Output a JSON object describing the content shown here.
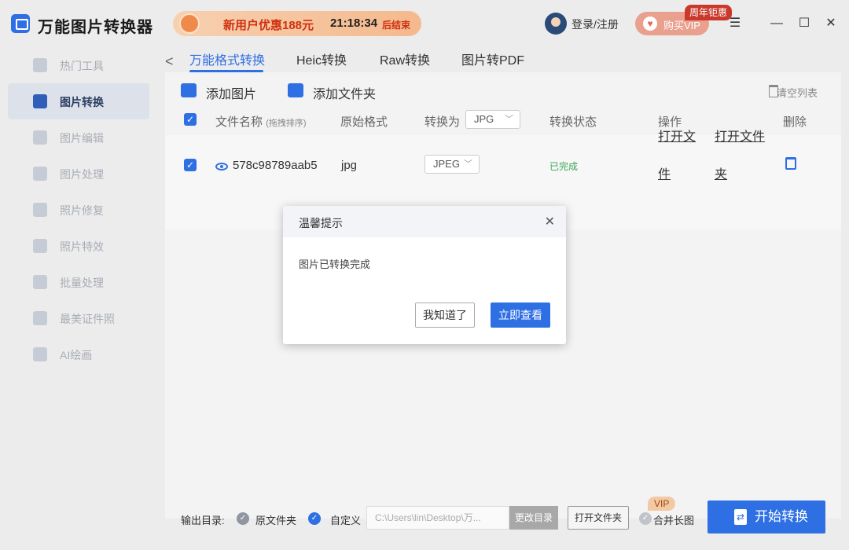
{
  "app": {
    "title": "万能图片转换器",
    "promo_text": "新用户优惠188元",
    "promo_time": "21:18:34",
    "promo_end": "后结束",
    "login": "登录/注册",
    "vip_button": "购买VIP",
    "vip_tag": "周年钜惠"
  },
  "window_controls": {
    "menu": "☰",
    "minimize": "—",
    "maximize": "☐",
    "close": "✕"
  },
  "sidebar": {
    "items": [
      {
        "label": "热门工具"
      },
      {
        "label": "图片转换"
      },
      {
        "label": "图片编辑"
      },
      {
        "label": "图片处理"
      },
      {
        "label": "照片修复"
      },
      {
        "label": "照片特效"
      },
      {
        "label": "批量处理"
      },
      {
        "label": "最美证件照"
      },
      {
        "label": "AI绘画"
      }
    ],
    "active_index": 1
  },
  "tabs": {
    "back": "<",
    "items": [
      {
        "label": "万能格式转换"
      },
      {
        "label": "Heic转换"
      },
      {
        "label": "Raw转换"
      },
      {
        "label": "图片转PDF"
      }
    ]
  },
  "toolbar": {
    "add_image": "添加图片",
    "add_folder": "添加文件夹",
    "clear_list": "清空列表"
  },
  "table": {
    "headers": {
      "filename": "文件名称",
      "filename_hint": "(拖拽排序)",
      "source_format": "原始格式",
      "convert_to": "转换为",
      "convert_to_value": "JPG",
      "status": "转换状态",
      "actions": "操作",
      "delete": "删除"
    },
    "rows": [
      {
        "filename": "578c98789aab5",
        "source_format": "jpg",
        "target_format": "JPEG",
        "status": "已完成",
        "open_file": "打开文件",
        "open_folder": "打开文件夹"
      }
    ]
  },
  "bottom": {
    "output_label": "输出目录:",
    "original_folder": "原文件夹",
    "custom": "自定义",
    "path": "C:\\Users\\lin\\Desktop\\万...",
    "change_dir": "更改目录",
    "open_folder": "打开文件夹",
    "vip": "VIP",
    "merge": "合并长图",
    "start": "开始转换"
  },
  "dialog": {
    "title": "温馨提示",
    "close": "✕",
    "message": "图片已转换完成",
    "ok": "我知道了",
    "view": "立即查看"
  },
  "colors": {
    "accent": "#2f6fe4",
    "success": "#3aa657",
    "promo_red": "#d0300f"
  }
}
